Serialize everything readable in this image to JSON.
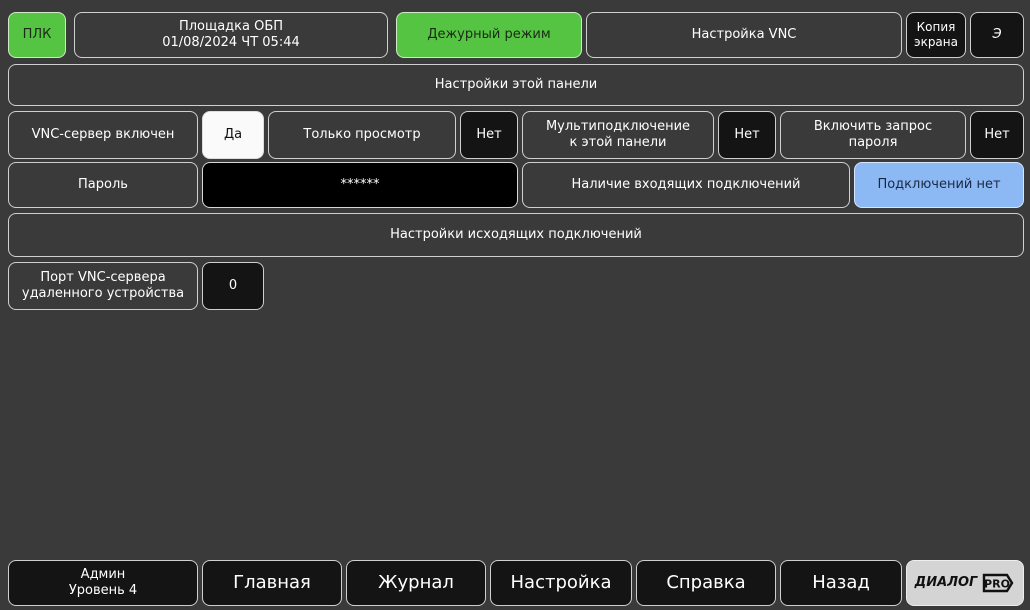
{
  "header": {
    "plc_label": "ПЛК",
    "site_name": "Площадка ОБП",
    "datetime": "01/08/2024 ЧТ 05:44",
    "mode": "Дежурный режим",
    "screen_title": "Настройка VNC",
    "screen_copy_line1": "Копия",
    "screen_copy_line2": "экрана",
    "e_label": "Э"
  },
  "panel": {
    "section_title": "Настройки этой панели",
    "vnc_enabled_label": "VNC-сервер включен",
    "vnc_enabled_value": "Да",
    "view_only_label": "Только просмотр",
    "view_only_value": "Нет",
    "multi_line1": "Мультиподключение",
    "multi_line2": "к этой панели",
    "multi_value": "Нет",
    "pwd_request_line1": "Включить запрос",
    "pwd_request_line2": "пароля",
    "pwd_request_value": "Нет",
    "password_label": "Пароль",
    "password_value": "******",
    "incoming_label": "Наличие входящих подключений",
    "incoming_value": "Подключений нет"
  },
  "outgoing": {
    "section_title": "Настройки исходящих подключений",
    "port_line1": "Порт VNC-сервера",
    "port_line2": "удаленного устройства",
    "port_value": "0"
  },
  "footer": {
    "user_name": "Админ",
    "user_level": "Уровень 4",
    "main": "Главная",
    "journal": "Журнал",
    "settings": "Настройка",
    "help": "Справка",
    "back": "Назад",
    "logo_text": "ДИАЛОГ",
    "logo_pro": "PRO"
  }
}
